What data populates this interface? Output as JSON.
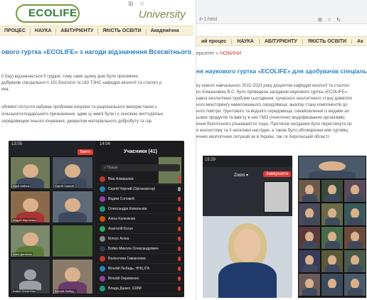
{
  "left": {
    "logo_text": "ECOLIFE",
    "university_label": "University",
    "nav": [
      "ПРОЦЕС",
      "НАУКА",
      "АБІТУРІЄНТУ",
      "ЯКІСТЬ ОСВІТИ",
      "Академічна"
    ],
    "news_title": "ового гуртка «ECOLIFE» з нагоди відзначення Всесвітнього дня",
    "para1": [
      "il Day) відзначається 5 грудня, тому саме цьому дню було присвячен",
      "добувачів спеціальності 101 Екологія та 183 ТЗНС кафедри екології та сталого р",
      "нка."
    ],
    "para2": [
      "обливої гостроти набуває проблема охорони та раціонального використання з",
      "сільськогосподарського призначення, адже ці землі були і є основою життєдіяльн",
      "середовищем їхнього існування, джерелом матеріального добробуту та гар"
    ],
    "phoneA": {
      "time": "13:05",
      "exit_label": "Вийти",
      "tiles": [
        "Юрій Кийчик",
        "Сергій Чорний",
        "Андрій Мартинюк",
        "",
        "Анна Данилюк",
        "",
        "Бойко Ольга Мик",
        "Віталій Любид..."
      ]
    },
    "phoneB": {
      "time": "14:04",
      "header": "Учасники (41)",
      "search": "Пошук",
      "participants": [
        {
          "name": "Віка Алмашова",
          "muted": true
        },
        {
          "name": "Сергій Чорний (Організатор)",
          "muted": false
        },
        {
          "name": "Вадим Соловей",
          "muted": true
        },
        {
          "name": "Олександра Ковальова",
          "muted": true
        },
        {
          "name": "Аліна Калюжная",
          "muted": true
        },
        {
          "name": "Анатолій Богун",
          "muted": true
        },
        {
          "name": "Білоус Аліна",
          "muted": true
        },
        {
          "name": "Бойко Микола Олександрович",
          "muted": true
        },
        {
          "name": "Валентина Гамаюнова",
          "muted": true
        },
        {
          "name": "Віталій Любидь, ННЦ ІГА",
          "muted": true
        },
        {
          "name": "Віталій Окрименко",
          "muted": true
        },
        {
          "name": "Влада Дашко, 618М",
          "muted": true
        }
      ]
    }
  },
  "right": {
    "url": "4-1.html",
    "nav": [
      "ий процес",
      "НАУКА",
      "АБІТУРІЄНТУ",
      "ЯКІСТЬ ОСВІТИ",
      "Ак"
    ],
    "crumb_prefix": "ерситет »",
    "crumb_active": "НОВИНИ",
    "news_title": "ня наукового гуртка «ECOLIFE» для здобувачів спеціальн",
    "para": [
      "ку нового навчального 2022-2023 року доцентом кафедри екології та сталого",
      "ко Алмашовою В.С. було проведено засідання наукового гуртка «ECOLIFE».",
      "кався екологічних проблем сьогодення: сучасного екологічного стану довкілля",
      "ного моніторингу навколишнього середовища; аналізу стану компонентів до",
      "ного повітря, ґрунтового та водного середовища; ознайомлення із видами ал",
      "ьових продуктів та вмісту в них ГМО (генетично модифікованих організмів)",
      "ення біологічного різноманіття тощо. Протягом засідання було переглянута пр",
      "я екосистему та її негативні наслідки, а також було обговорення між гуртківц",
      "ичних екологічних ситуацій як в Україні, так і в Херсонській області."
    ],
    "call": {
      "time": "15:29",
      "zoom_label": "Zoom ▾",
      "end_label": "Завершити"
    }
  }
}
